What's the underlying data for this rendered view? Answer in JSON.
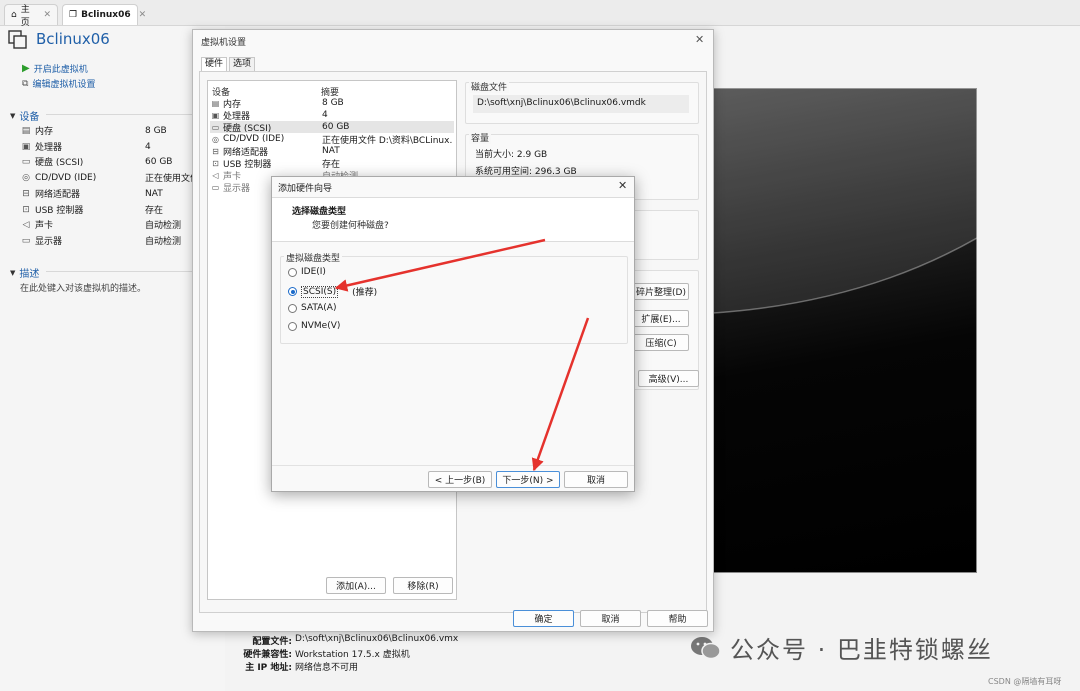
{
  "tabs": [
    {
      "label": "主页",
      "icon": "home-icon"
    },
    {
      "label": "Bclinux06",
      "icon": "vm-icon"
    }
  ],
  "vm": {
    "name": "Bclinux06",
    "actions": [
      "开启此虚拟机",
      "编辑虚拟机设置"
    ]
  },
  "devices_section": {
    "title": "设备",
    "items": [
      {
        "name": "内存",
        "value": "8 GB",
        "icon": "memory-icon"
      },
      {
        "name": "处理器",
        "value": "4",
        "icon": "cpu-icon"
      },
      {
        "name": "硬盘 (SCSI)",
        "value": "60 GB",
        "icon": "disk-icon"
      },
      {
        "name": "CD/DVD (IDE)",
        "value": "正在使用文件",
        "icon": "cd-icon"
      },
      {
        "name": "网络适配器",
        "value": "NAT",
        "icon": "network-icon"
      },
      {
        "name": "USB 控制器",
        "value": "存在",
        "icon": "usb-icon"
      },
      {
        "name": "声卡",
        "value": "自动检测",
        "icon": "speaker-icon"
      },
      {
        "name": "显示器",
        "value": "自动检测",
        "icon": "monitor-icon"
      }
    ]
  },
  "description_section": {
    "title": "描述",
    "placeholder": "在此处键入对该虚拟机的描述。"
  },
  "details": [
    {
      "key": "配置文件:",
      "value": "D:\\soft\\xnj\\Bclinux06\\Bclinux06.vmx"
    },
    {
      "key": "硬件兼容性:",
      "value": "Workstation 17.5.x 虚拟机"
    },
    {
      "key": "主 IP 地址:",
      "value": "网络信息不可用"
    }
  ],
  "watermark": "公众号 · 巴韭特锁螺丝",
  "credit": "CSDN @隔墙有耳呀",
  "settings_dialog": {
    "title": "虚拟机设置",
    "tabs": [
      "硬件",
      "选项"
    ],
    "list_headers": [
      "设备",
      "摘要"
    ],
    "hardware": [
      {
        "name": "内存",
        "value": "8 GB",
        "icon": "memory-icon"
      },
      {
        "name": "处理器",
        "value": "4",
        "icon": "cpu-icon"
      },
      {
        "name": "硬盘 (SCSI)",
        "value": "60 GB",
        "icon": "disk-icon"
      },
      {
        "name": "CD/DVD (IDE)",
        "value": "正在使用文件 D:\\资料\\BCLinux...",
        "icon": "cd-icon"
      },
      {
        "name": "网络适配器",
        "value": "NAT",
        "icon": "network-icon"
      },
      {
        "name": "USB 控制器",
        "value": "存在",
        "icon": "usb-icon"
      },
      {
        "name": "声卡",
        "value": "自动检测",
        "icon": "speaker-icon"
      },
      {
        "name": "显示器",
        "value": "",
        "icon": "monitor-icon"
      }
    ],
    "disk_file_label": "磁盘文件",
    "disk_file_value": "D:\\soft\\xnj\\Bclinux06\\Bclinux06.vmdk",
    "capacity_label": "容量",
    "current_size": "当前大小: 2.9 GB",
    "free_space": "系统可用空间: 296.3 GB",
    "util_buttons": [
      "碎片整理(D)",
      "扩展(E)...",
      "压缩(C)",
      "高级(V)..."
    ],
    "list_buttons": [
      "添加(A)...",
      "移除(R)"
    ],
    "footer_buttons": [
      "确定",
      "取消",
      "帮助"
    ]
  },
  "wizard": {
    "title": "添加硬件向导",
    "heading": "选择磁盘类型",
    "subheading": "您要创建何种磁盘?",
    "group_label": "虚拟磁盘类型",
    "options": [
      {
        "label": "IDE(I)",
        "selected": false
      },
      {
        "label": "SCSI(S)",
        "selected": true,
        "note": "(推荐)"
      },
      {
        "label": "SATA(A)",
        "selected": false
      },
      {
        "label": "NVMe(V)",
        "selected": false
      }
    ],
    "buttons": [
      "< 上一步(B)",
      "下一步(N) >",
      "取消"
    ]
  },
  "colors": {
    "accent": "#1f5fa8",
    "arrow": "#e5322d",
    "primary_border": "#4a8fd8"
  }
}
